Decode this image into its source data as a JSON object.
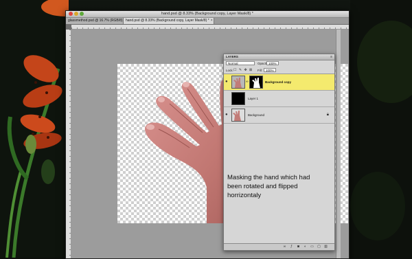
{
  "window": {
    "title": "hand.psd @ 8.33% (Background copy, Layer Mask/8) *"
  },
  "tabs": [
    {
      "label": "glassmethod.psd @ 16.7% (RGB/8)"
    },
    {
      "label": "hand.psd @ 8.33% (Background copy, Layer Mask/8) *"
    }
  ],
  "layers_panel": {
    "tab_label": "LAYERS",
    "menu_icon": "panel-menu-icon",
    "blend_mode": "Normal",
    "opacity_label": "Opacity:",
    "opacity_value": "100%",
    "lock_label": "Lock:",
    "fill_label": "Fill:",
    "fill_value": "100%",
    "layers": [
      {
        "name": "Background copy",
        "active": true
      },
      {
        "name": "Layer 1",
        "active": false
      },
      {
        "name": "Background",
        "active": false
      }
    ],
    "bottom_icons": [
      "link-icon",
      "fx-icon",
      "mask-icon",
      "adjustment-icon",
      "group-icon",
      "new-layer-icon",
      "trash-icon"
    ]
  },
  "annotation": {
    "text": "Masking the hand which had been rotated and flipped horrizontaly"
  },
  "colors": {
    "active_layer": "#f4ea6e",
    "canvas_bg": "#9c9c9c"
  }
}
